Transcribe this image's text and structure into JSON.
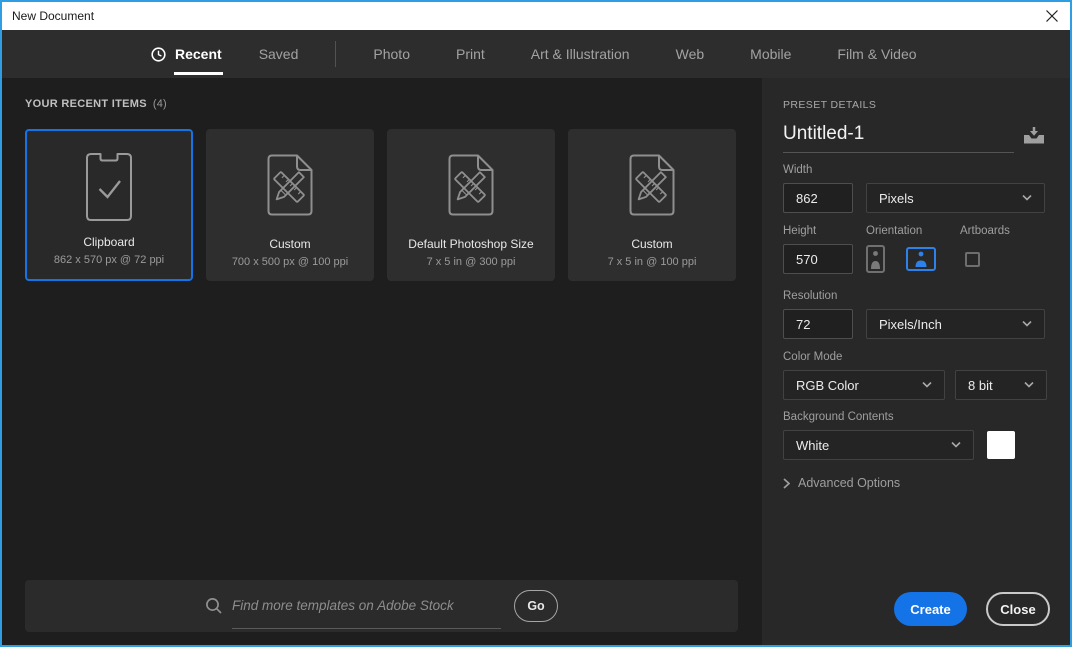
{
  "window": {
    "title": "New Document"
  },
  "tabs": {
    "items": [
      {
        "label": "Recent"
      },
      {
        "label": "Saved"
      },
      {
        "label": "Photo"
      },
      {
        "label": "Print"
      },
      {
        "label": "Art & Illustration"
      },
      {
        "label": "Web"
      },
      {
        "label": "Mobile"
      },
      {
        "label": "Film & Video"
      }
    ]
  },
  "recent": {
    "heading": "YOUR RECENT ITEMS",
    "count": "(4)",
    "cards": [
      {
        "icon": "clipboard",
        "title": "Clipboard",
        "subtitle": "862 x 570 px @ 72 ppi",
        "selected": true
      },
      {
        "icon": "document-ruler-pencil",
        "title": "Custom",
        "subtitle": "700 x 500 px @ 100 ppi",
        "selected": false
      },
      {
        "icon": "document-ruler-pencil",
        "title": "Default Photoshop Size",
        "subtitle": "7 x 5 in @ 300 ppi",
        "selected": false
      },
      {
        "icon": "document-ruler-pencil",
        "title": "Custom",
        "subtitle": "7 x 5 in @ 100 ppi",
        "selected": false
      }
    ]
  },
  "search": {
    "placeholder": "Find more templates on Adobe Stock",
    "go_label": "Go"
  },
  "preset": {
    "heading": "PRESET DETAILS",
    "name": "Untitled-1",
    "width_label": "Width",
    "width_value": "862",
    "width_unit": "Pixels",
    "height_label": "Height",
    "height_value": "570",
    "orientation_label": "Orientation",
    "artboards_label": "Artboards",
    "resolution_label": "Resolution",
    "resolution_value": "72",
    "resolution_unit": "Pixels/Inch",
    "color_mode_label": "Color Mode",
    "color_mode_value": "RGB Color",
    "bit_depth_value": "8 bit",
    "background_label": "Background Contents",
    "background_value": "White",
    "advanced_label": "Advanced Options",
    "create_label": "Create",
    "close_label": "Close"
  },
  "colors": {
    "accent": "#1473e6",
    "window_border": "#2f9de2",
    "selected_card_border": "#1473e6"
  }
}
